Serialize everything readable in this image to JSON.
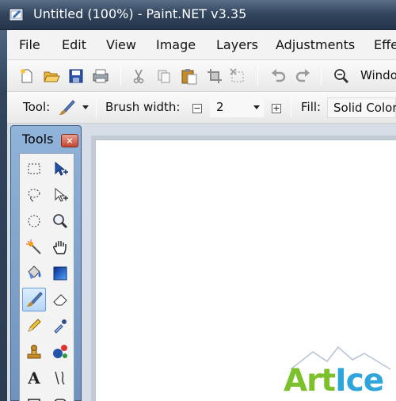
{
  "window": {
    "title": "Untitled (100%) - Paint.NET v3.35"
  },
  "menu": {
    "items": [
      "File",
      "Edit",
      "View",
      "Image",
      "Layers",
      "Adjustments",
      "Effe"
    ]
  },
  "toolbar": {
    "buttons": [
      "new-icon",
      "open-icon",
      "save-icon",
      "print-icon",
      "cut-icon",
      "copy-icon",
      "paste-icon",
      "crop-icon",
      "deselect-icon",
      "undo-icon",
      "redo-icon",
      "zoom-icon"
    ],
    "window_label": "Windo"
  },
  "tool_options": {
    "tool_label": "Tool:",
    "brush_width_label": "Brush width:",
    "brush_width_value": "2",
    "fill_label": "Fill:",
    "fill_value": "Solid Color"
  },
  "tools_window": {
    "title": "Tools",
    "close_glyph": "×",
    "tools": [
      "rectangle-select-icon",
      "move-selection-icon",
      "lasso-select-icon",
      "move-selected-icon",
      "ellipse-select-icon",
      "zoom-icon",
      "magic-wand-icon",
      "pan-icon",
      "paint-bucket-icon",
      "gradient-icon",
      "paintbrush-icon",
      "eraser-icon",
      "pencil-icon",
      "color-picker-icon",
      "clone-stamp-icon",
      "recolor-icon",
      "text-icon",
      "line-curve-icon"
    ],
    "selected_tool": "paintbrush-icon",
    "text_tool_glyph": "A"
  },
  "watermark": {
    "part1": "Art",
    "part2": "Ice",
    "color1": "#7cc02b",
    "color2": "#2ea6dc"
  }
}
